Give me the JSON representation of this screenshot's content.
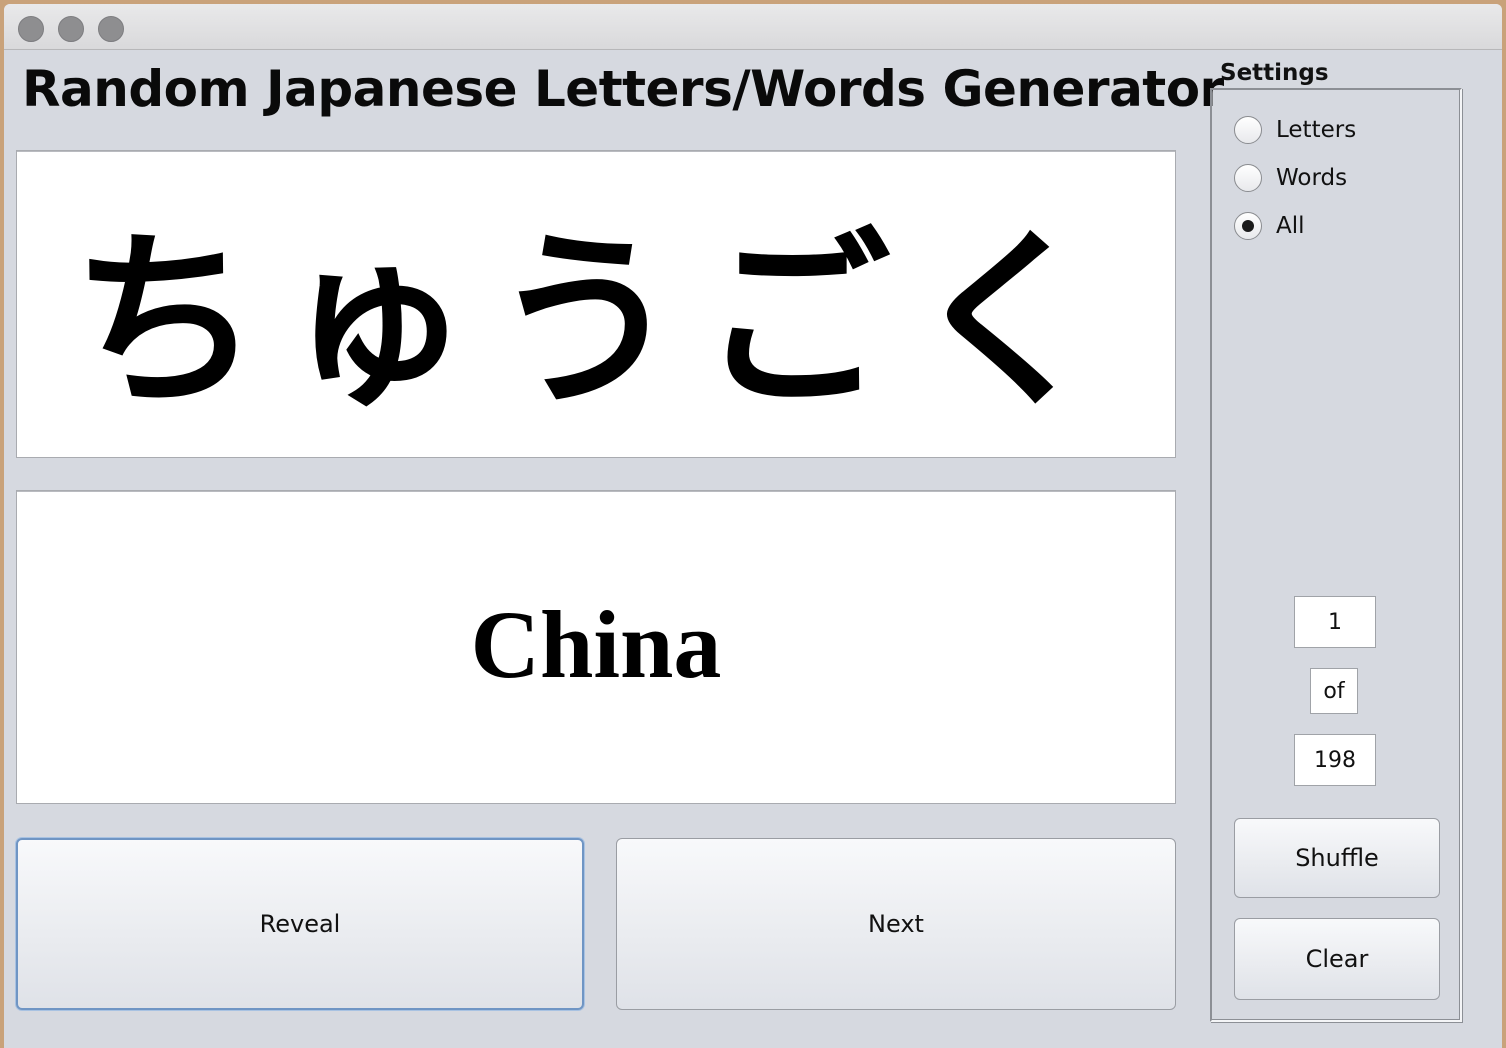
{
  "window": {
    "title_text": "Random Japanese Letters/Words Generator"
  },
  "display": {
    "kana": "ちゅうごく",
    "meaning": "China"
  },
  "buttons": {
    "reveal": "Reveal",
    "next": "Next",
    "shuffle": "Shuffle",
    "clear": "Clear"
  },
  "settings": {
    "label": "Settings",
    "options": [
      {
        "label": "Letters",
        "checked": false
      },
      {
        "label": "Words",
        "checked": false
      },
      {
        "label": "All",
        "checked": true
      }
    ]
  },
  "counter": {
    "current": "1",
    "of_label": "of",
    "total": "198"
  },
  "colors": {
    "window_bg": "#d6d9e0",
    "focus_ring": "#6f95c4"
  }
}
